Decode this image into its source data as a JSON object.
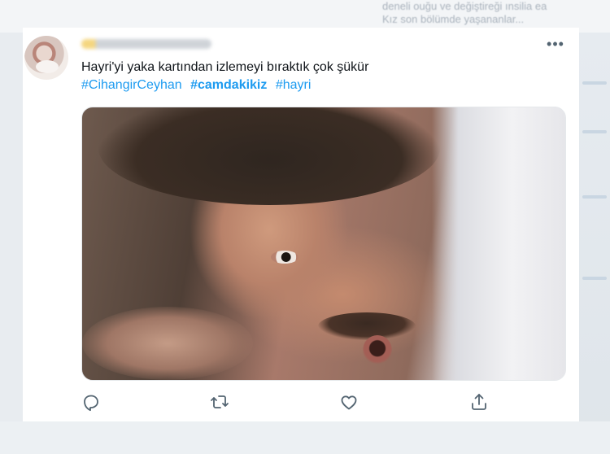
{
  "background": {
    "ghost_lines": [
      "deneli ouğu ve değiştireği ınsilia ea",
      "Kız son bölümde yaşananlar..."
    ]
  },
  "tweet": {
    "text": "Hayri'yi yaka kartından izlemeyi bıraktık çok şükür",
    "hashtags": [
      {
        "label": "#CihangirCeyhan",
        "bold": false
      },
      {
        "label": "#camdakikiz",
        "bold": true
      },
      {
        "label": "#hayri",
        "bold": false
      }
    ],
    "more_label": "•••",
    "media": {
      "icon": "photo-still"
    },
    "actions": [
      {
        "name": "reply",
        "icon": "reply-icon"
      },
      {
        "name": "retweet",
        "icon": "retweet-icon"
      },
      {
        "name": "like",
        "icon": "heart-icon"
      },
      {
        "name": "share",
        "icon": "share-icon"
      }
    ]
  },
  "colors": {
    "accent": "#1d9bf0",
    "text": "#0f1419",
    "icon": "#536471"
  }
}
